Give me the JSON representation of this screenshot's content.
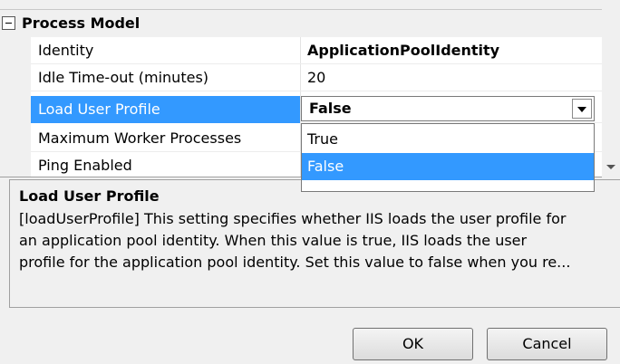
{
  "grid": {
    "category": "Process Model",
    "properties": [
      {
        "name": "Identity",
        "value": "ApplicationPoolIdentity",
        "bold": true
      },
      {
        "name": "Idle Time-out (minutes)",
        "value": "20",
        "bold": false
      },
      {
        "name": "Load User Profile",
        "value": "False",
        "bold": true
      },
      {
        "name": "Maximum Worker Processes",
        "value": "",
        "bold": false
      },
      {
        "name": "Ping Enabled",
        "value": "",
        "bold": false
      }
    ],
    "selected": "Load User Profile"
  },
  "dropdown": {
    "current_value": "False",
    "options": [
      "True",
      "False"
    ],
    "highlighted": "False"
  },
  "description": {
    "title": "Load User Profile",
    "text": "[loadUserProfile] This setting specifies whether IIS loads the user profile for\nan application pool identity. When this value is true, IIS loads the user\nprofile for the application pool identity. Set this value to false when you re..."
  },
  "buttons": {
    "ok": "OK",
    "cancel": "Cancel"
  },
  "colors": {
    "selection": "#3399ff",
    "background": "#f0f0f0"
  }
}
